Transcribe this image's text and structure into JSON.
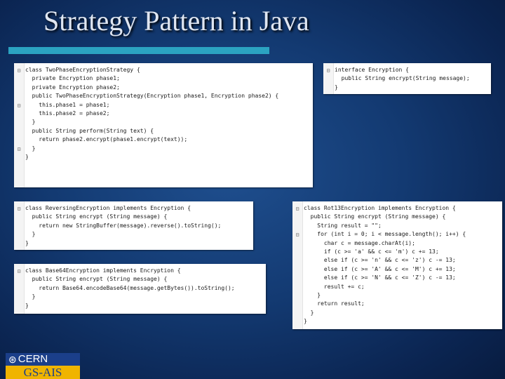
{
  "slide": {
    "title": "Strategy Pattern in Java",
    "logo_top": "CERN",
    "logo_bottom": "GS-AIS"
  },
  "colors": {
    "accent_bar": "#2ba3c1",
    "cern_blue": "#1b3f8a",
    "gsais_yellow": "#f0b400"
  },
  "panels": {
    "twophase": {
      "lines": [
        "class TwoPhaseEncryptionStrategy {",
        "  private Encryption phase1;",
        "  private Encryption phase2;",
        "",
        "  public TwoPhaseEncryptionStrategy(Encryption phase1, Encryption phase2) {",
        "    this.phase1 = phase1;",
        "    this.phase2 = phase2;",
        "  }",
        "",
        "  public String perform(String text) {",
        "    return phase2.encrypt(phase1.encrypt(text));",
        "  }",
        "}"
      ]
    },
    "interface": {
      "lines": [
        "interface Encryption {",
        "  public String encrypt(String message);",
        "}"
      ]
    },
    "reversing": {
      "lines": [
        "class ReversingEncryption implements Encryption {",
        "  public String encrypt (String message) {",
        "    return new StringBuffer(message).reverse().toString();",
        "  }",
        "}"
      ]
    },
    "base64": {
      "lines": [
        "class Base64Encryption implements Encryption {",
        "  public String encrypt (String message) {",
        "    return Base64.encodeBase64(message.getBytes()).toString();",
        "  }",
        "}"
      ]
    },
    "rot13": {
      "lines": [
        "class Rot13Encryption implements Encryption {",
        "  public String encrypt (String message) {",
        "    String result = \"\";",
        "    for (int i = 0; i < message.length(); i++) {",
        "      char c = message.charAt(i);",
        "      if (c >= 'a' && c <= 'm') c += 13;",
        "      else if (c >= 'n' && c <= 'z') c -= 13;",
        "      else if (c >= 'A' && c <= 'M') c += 13;",
        "      else if (c >= 'N' && c <= 'Z') c -= 13;",
        "      result += c;",
        "    }",
        "    return result;",
        "  }",
        "}"
      ]
    }
  }
}
